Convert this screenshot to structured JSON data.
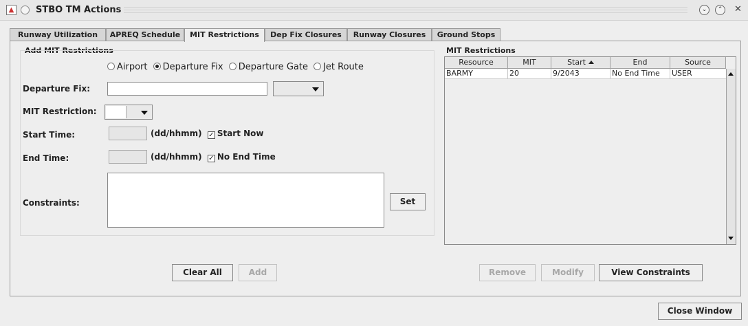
{
  "window": {
    "title": "STBO TM Actions"
  },
  "tabs": [
    {
      "label": "Runway Utilization"
    },
    {
      "label": "APREQ Schedule"
    },
    {
      "label": "MIT Restrictions"
    },
    {
      "label": "Dep Fix Closures"
    },
    {
      "label": "Runway Closures"
    },
    {
      "label": "Ground Stops"
    }
  ],
  "active_tab": "MIT Restrictions",
  "add_group": {
    "title": "Add MIT Restrictions",
    "radio_options": [
      {
        "label": "Airport",
        "checked": false
      },
      {
        "label": "Departure Fix",
        "checked": true
      },
      {
        "label": "Departure Gate",
        "checked": false
      },
      {
        "label": "Jet Route",
        "checked": false
      }
    ],
    "departure_fix_label": "Departure Fix:",
    "departure_fix_value": "",
    "mit_restriction_label": "MIT Restriction:",
    "start_time_label": "Start Time:",
    "start_time_format": "(dd/hhmm)",
    "start_now_label": "Start Now",
    "start_now_checked": true,
    "end_time_label": "End Time:",
    "end_time_format": "(dd/hhmm)",
    "no_end_time_label": "No End Time",
    "no_end_time_checked": true,
    "constraints_label": "Constraints:",
    "set_button": "Set",
    "clear_all_button": "Clear All",
    "add_button": "Add"
  },
  "restrictions_group": {
    "title": "MIT Restrictions",
    "columns": [
      "Resource",
      "MIT",
      "Start",
      "End",
      "Source"
    ],
    "sorted_column": "Start",
    "rows": [
      {
        "resource": "BARMY",
        "mit": "20",
        "start": "9/2043",
        "end": "No End Time",
        "source": "USER"
      }
    ],
    "remove_button": "Remove",
    "modify_button": "Modify",
    "view_constraints_button": "View Constraints"
  },
  "footer": {
    "close_window_button": "Close Window"
  }
}
